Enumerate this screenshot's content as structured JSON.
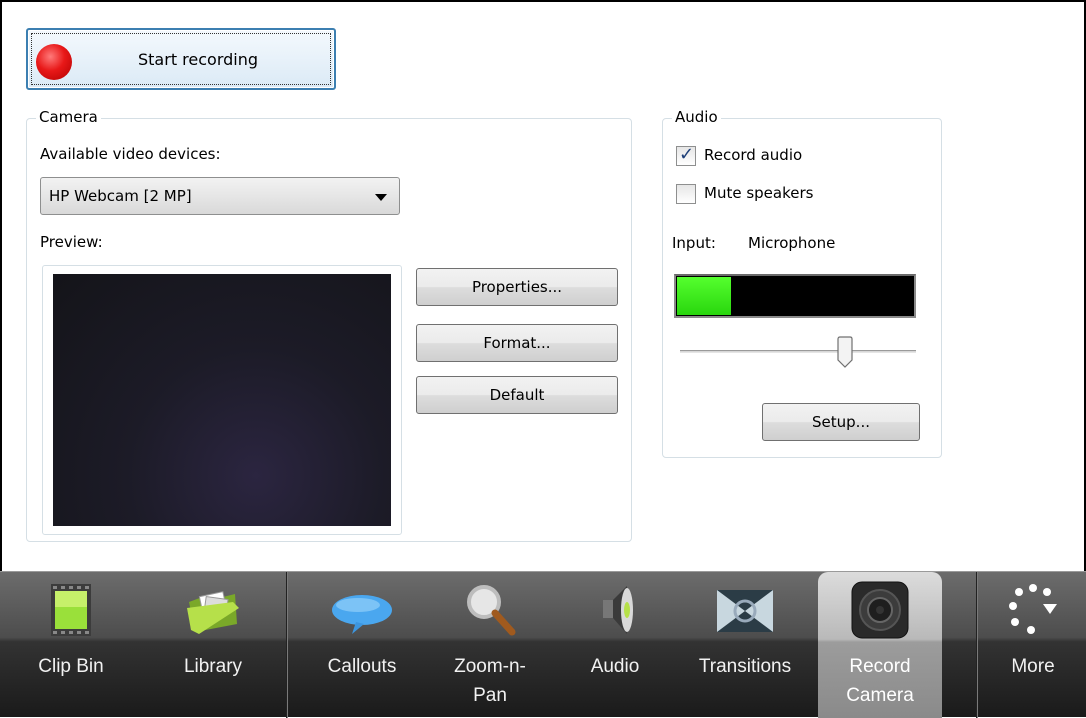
{
  "record_button": {
    "label": "Start recording"
  },
  "camera": {
    "title": "Camera",
    "devices_label": "Available video devices:",
    "selected_device": "HP Webcam [2 MP]",
    "preview_label": "Preview:",
    "properties_label": "Properties...",
    "format_label": "Format...",
    "default_label": "Default"
  },
  "audio": {
    "title": "Audio",
    "record_audio_label": "Record audio",
    "record_audio_checked": true,
    "mute_speakers_label": "Mute speakers",
    "mute_speakers_checked": false,
    "input_label": "Input:",
    "input_value": "Microphone",
    "level_fraction": 0.23,
    "volume_fraction": 0.7,
    "setup_label": "Setup..."
  },
  "toolbar": {
    "items": [
      {
        "label": "Clip Bin",
        "icon": "film-icon"
      },
      {
        "label": "Library",
        "icon": "folder-icon"
      },
      {
        "label": "Callouts",
        "icon": "speech-bubble-icon"
      },
      {
        "label": "Zoom-n-Pan",
        "icon": "magnifier-icon"
      },
      {
        "label": "Audio",
        "icon": "speaker-icon"
      },
      {
        "label": "Transitions",
        "icon": "transitions-icon"
      },
      {
        "label": "Record Camera",
        "icon": "camera-icon",
        "active": true
      },
      {
        "label": "More",
        "icon": "more-dots-icon"
      }
    ]
  },
  "colors": {
    "level_green": "#33e81a",
    "record_red": "#e81818",
    "focus_blue": "#3c7fb1"
  }
}
